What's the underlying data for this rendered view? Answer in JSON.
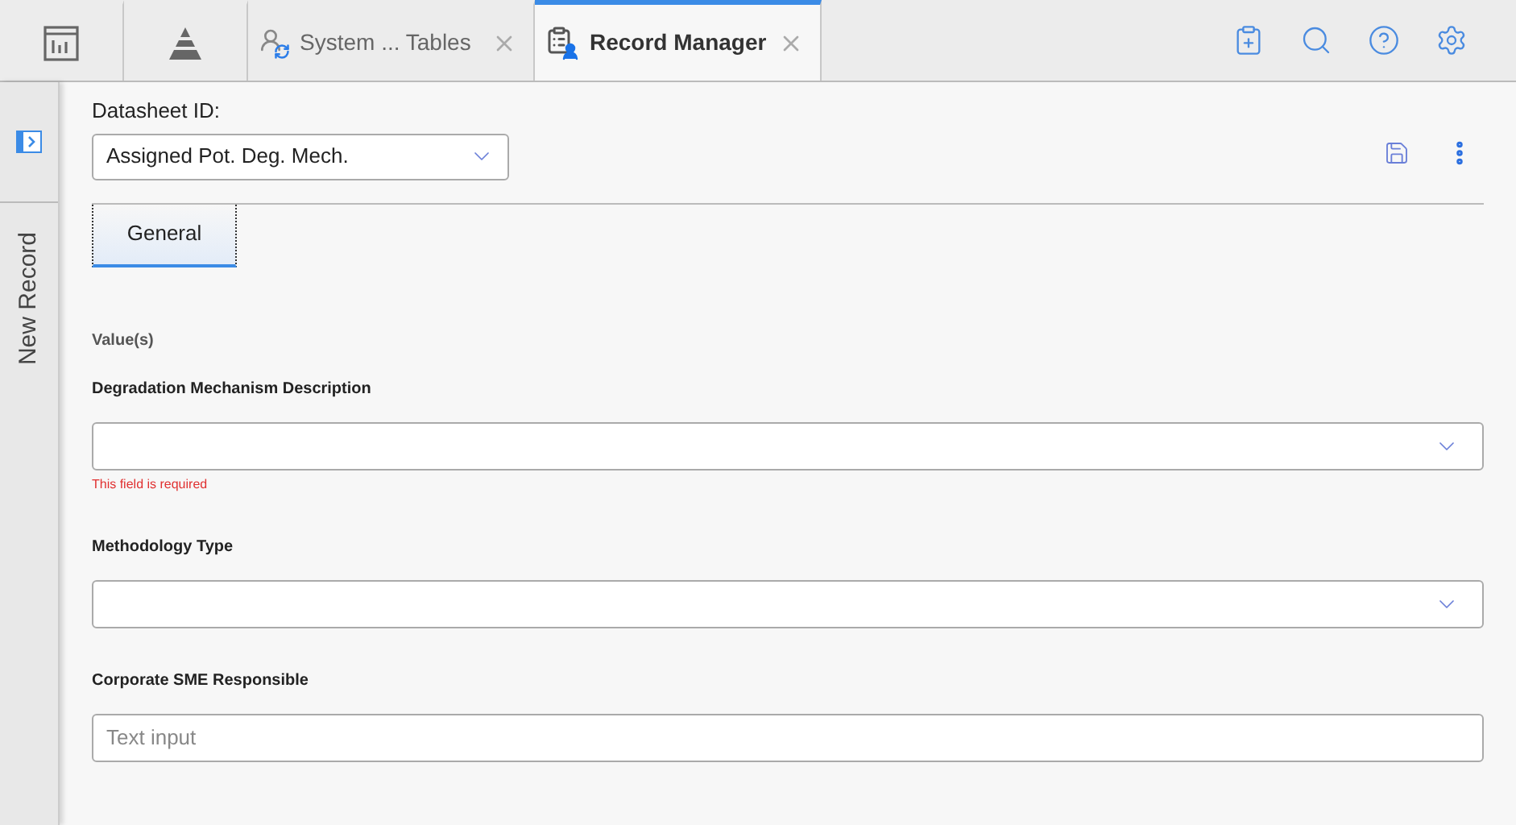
{
  "tabs": [
    {
      "kind": "icon",
      "selected": false
    },
    {
      "kind": "icon",
      "selected": false
    },
    {
      "kind": "text",
      "label": "System ... Tables",
      "selected": false
    },
    {
      "kind": "text",
      "label": "Record Manager",
      "selected": true
    }
  ],
  "sidebar": {
    "label": "New Record"
  },
  "datasheet": {
    "label": "Datasheet ID:",
    "value": "Assigned Pot. Deg. Mech."
  },
  "section_tabs": [
    {
      "label": "General",
      "selected": true
    }
  ],
  "section_title": "Value(s)",
  "fields": [
    {
      "kind": "select",
      "label": "Degradation Mechanism Description",
      "error": "This field is required"
    },
    {
      "kind": "select",
      "label": "Methodology Type"
    },
    {
      "kind": "text",
      "label": "Corporate SME Responsible",
      "placeholder": "Text input"
    }
  ]
}
